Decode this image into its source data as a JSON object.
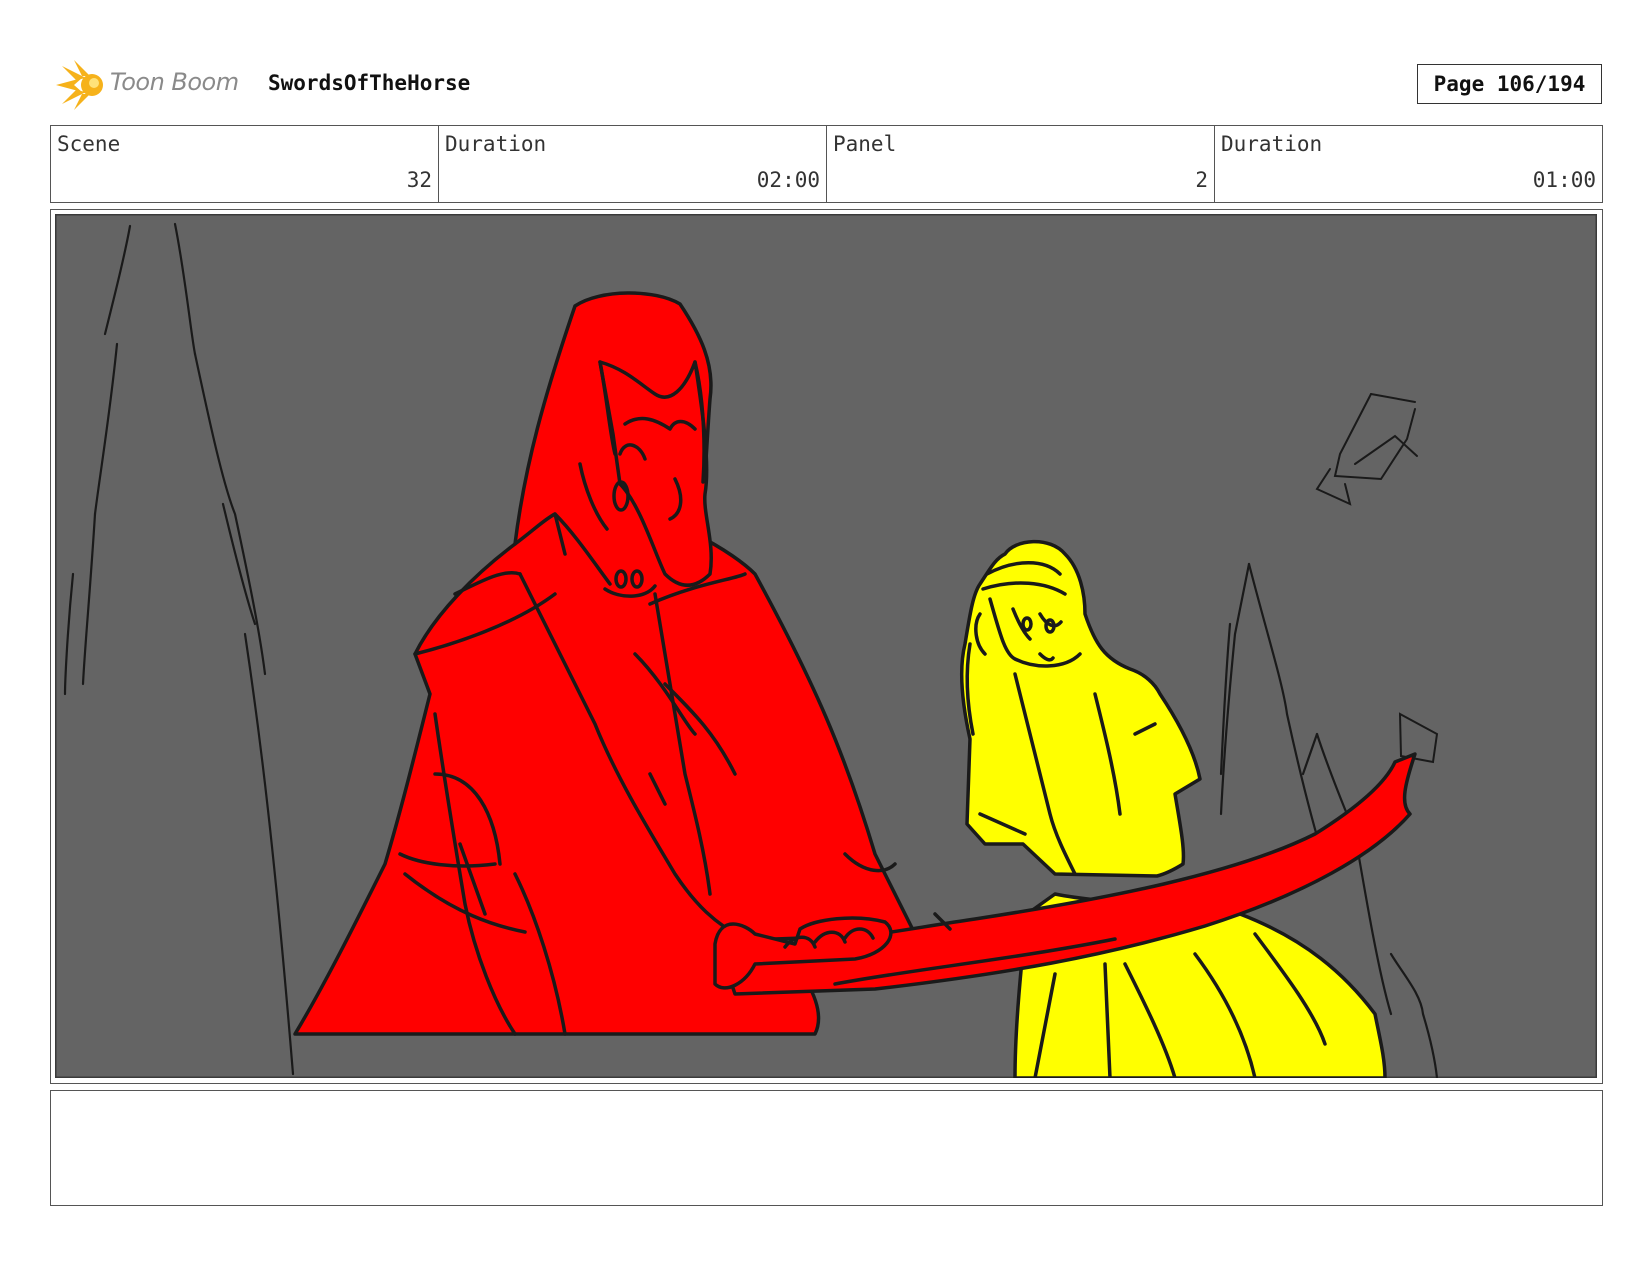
{
  "header": {
    "logo_text": "Toon Boom",
    "project_title": "SwordsOfTheHorse",
    "page_label": "Page 106/194"
  },
  "info": {
    "scene_label": "Scene",
    "scene_value": "32",
    "scene_duration_label": "Duration",
    "scene_duration_value": "02:00",
    "panel_label": "Panel",
    "panel_value": "2",
    "panel_duration_label": "Duration",
    "panel_duration_value": "01:00"
  },
  "colors": {
    "background_gray": "#646464",
    "horse_red": "#ff0000",
    "girl_yellow": "#ffff00",
    "line_ink": "#1a1a1a",
    "logo_orange": "#f6b21b"
  },
  "notes": {
    "text": ""
  }
}
